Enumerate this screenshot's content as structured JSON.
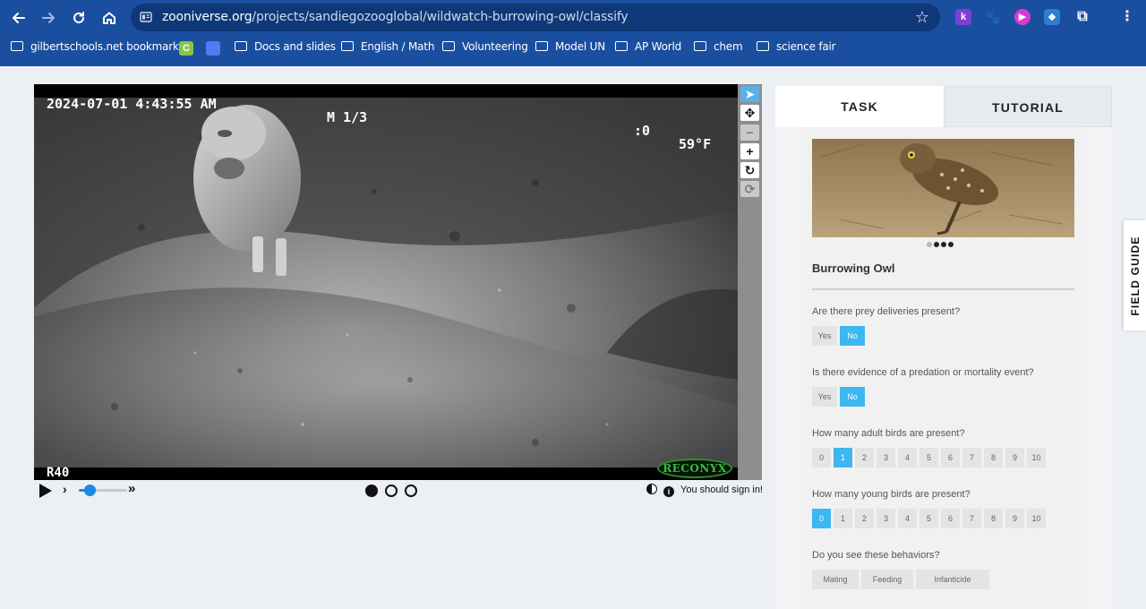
{
  "browser": {
    "url_host": "zooniverse.org",
    "url_path": "/projects/sandiegozooglobal/wildwatch-burrowing-owl/classify",
    "extensions": [
      "k-extension-icon",
      "cat-extension-icon",
      "camera-extension-icon",
      "puzzle-color-extension-icon"
    ],
    "bookmarks": [
      {
        "label": "gilbertschools.net bookmarks",
        "kind": "managed-folder"
      },
      {
        "label": "",
        "kind": "app-c-icon"
      },
      {
        "label": "",
        "kind": "app-blue-icon"
      },
      {
        "label": "Docs and slides",
        "kind": "folder"
      },
      {
        "label": "English / Math",
        "kind": "folder"
      },
      {
        "label": "Volunteering",
        "kind": "folder"
      },
      {
        "label": "Model UN",
        "kind": "folder"
      },
      {
        "label": "AP World",
        "kind": "folder"
      },
      {
        "label": "chem",
        "kind": "folder"
      },
      {
        "label": "science fair",
        "kind": "folder"
      }
    ]
  },
  "viewer": {
    "timestamp": "2024-07-01 4:43:55 AM",
    "frame": "M 1/3",
    "moon": ":0",
    "temperature": "59°F",
    "camera_id": "R40",
    "brand": "RECONYX",
    "tools": [
      "pointer-icon",
      "move-icon",
      "zoom-out-icon",
      "zoom-in-icon",
      "rotate-icon",
      "reset-icon"
    ],
    "frames_total": 3,
    "frame_selected": 1,
    "playback_speed": 0.22,
    "sign_in_text": "You should sign in!"
  },
  "panel": {
    "tabs": [
      "TASK",
      "TUTORIAL"
    ],
    "active_tab": "TASK",
    "species": "Burrowing Owl",
    "image_pages": 4,
    "image_page_active": 1,
    "questions": [
      {
        "text": "Are there prey deliveries present?",
        "options": [
          "Yes",
          "No"
        ],
        "selected": "No"
      },
      {
        "text": "Is there evidence of a predation or mortality event?",
        "options": [
          "Yes",
          "No"
        ],
        "selected": "No"
      },
      {
        "text": "How many adult birds are present?",
        "options": [
          "0",
          "1",
          "2",
          "3",
          "4",
          "5",
          "6",
          "7",
          "8",
          "9",
          "10"
        ],
        "selected": "1"
      },
      {
        "text": "How many young birds are present?",
        "options": [
          "0",
          "1",
          "2",
          "3",
          "4",
          "5",
          "6",
          "7",
          "8",
          "9",
          "10"
        ],
        "selected": "0"
      },
      {
        "text": "Do you see these behaviors?",
        "options": [
          "Mating",
          "Feeding",
          "Infanticide"
        ],
        "selected": ""
      }
    ],
    "field_guide": "FIELD GUIDE"
  },
  "colors": {
    "chrome": "#1a4fa0",
    "selected_option": "#3db7ef",
    "active_tool": "#5ab1e8",
    "page_bg": "#eceff4"
  }
}
